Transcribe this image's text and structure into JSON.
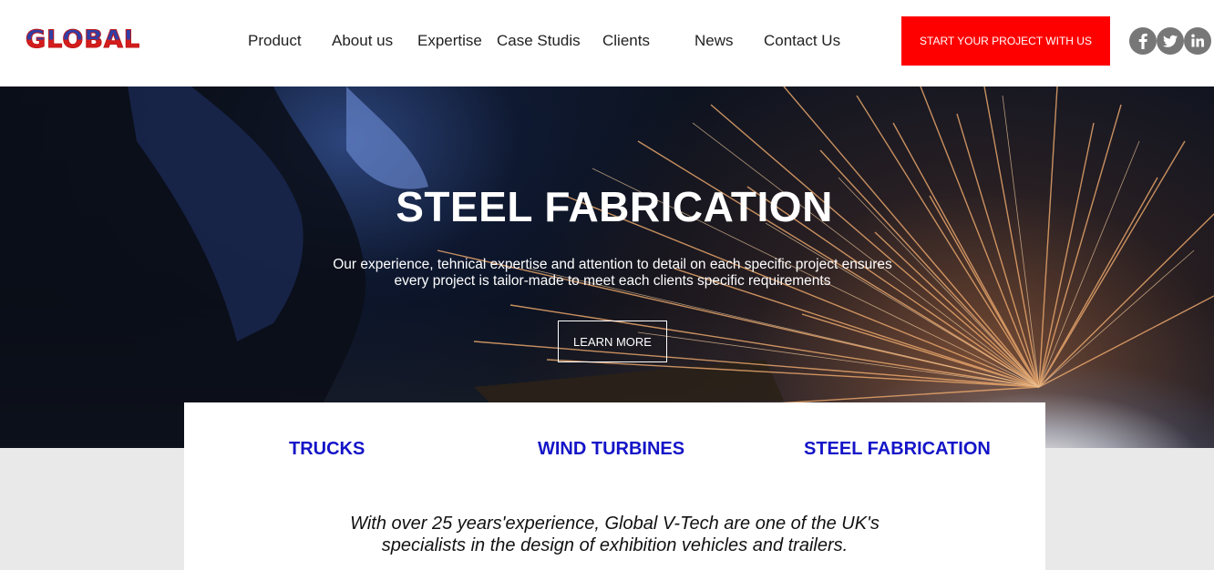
{
  "brand": {
    "logo_text": "GLOBAL"
  },
  "nav": {
    "items": [
      {
        "label": "Product"
      },
      {
        "label": "About us"
      },
      {
        "label": "Expertise"
      },
      {
        "label": "Case Studis"
      },
      {
        "label": "Clients"
      },
      {
        "label": "News"
      },
      {
        "label": "Contact Us"
      }
    ],
    "cta_label": "START YOUR PROJECT WITH US"
  },
  "social": [
    {
      "name": "facebook-icon",
      "glyph": "f"
    },
    {
      "name": "twitter-icon",
      "glyph": "t"
    },
    {
      "name": "linkedin-icon",
      "glyph": "in"
    }
  ],
  "hero": {
    "title": "STEEL FABRICATION",
    "subtitle_line1": "Our experience, tehnical expertise and attention to detail on each specific project ensures",
    "subtitle_line2": "every project is tailor-made to meet each clients specific requirements",
    "button_label": "LEARN MORE"
  },
  "categories": [
    {
      "label": "TRUCKS"
    },
    {
      "label": "WIND TURBINES"
    },
    {
      "label": "STEEL FABRICATION"
    }
  ],
  "intro": {
    "line1": "With over 25 years'experience, Global V-Tech are one of the UK's",
    "line2": "specialists in the design of exhibition vehicles and trailers."
  },
  "colors": {
    "cta_background": "#ff0000",
    "category_text": "#1414c8",
    "social_icon_bg": "#777777"
  }
}
